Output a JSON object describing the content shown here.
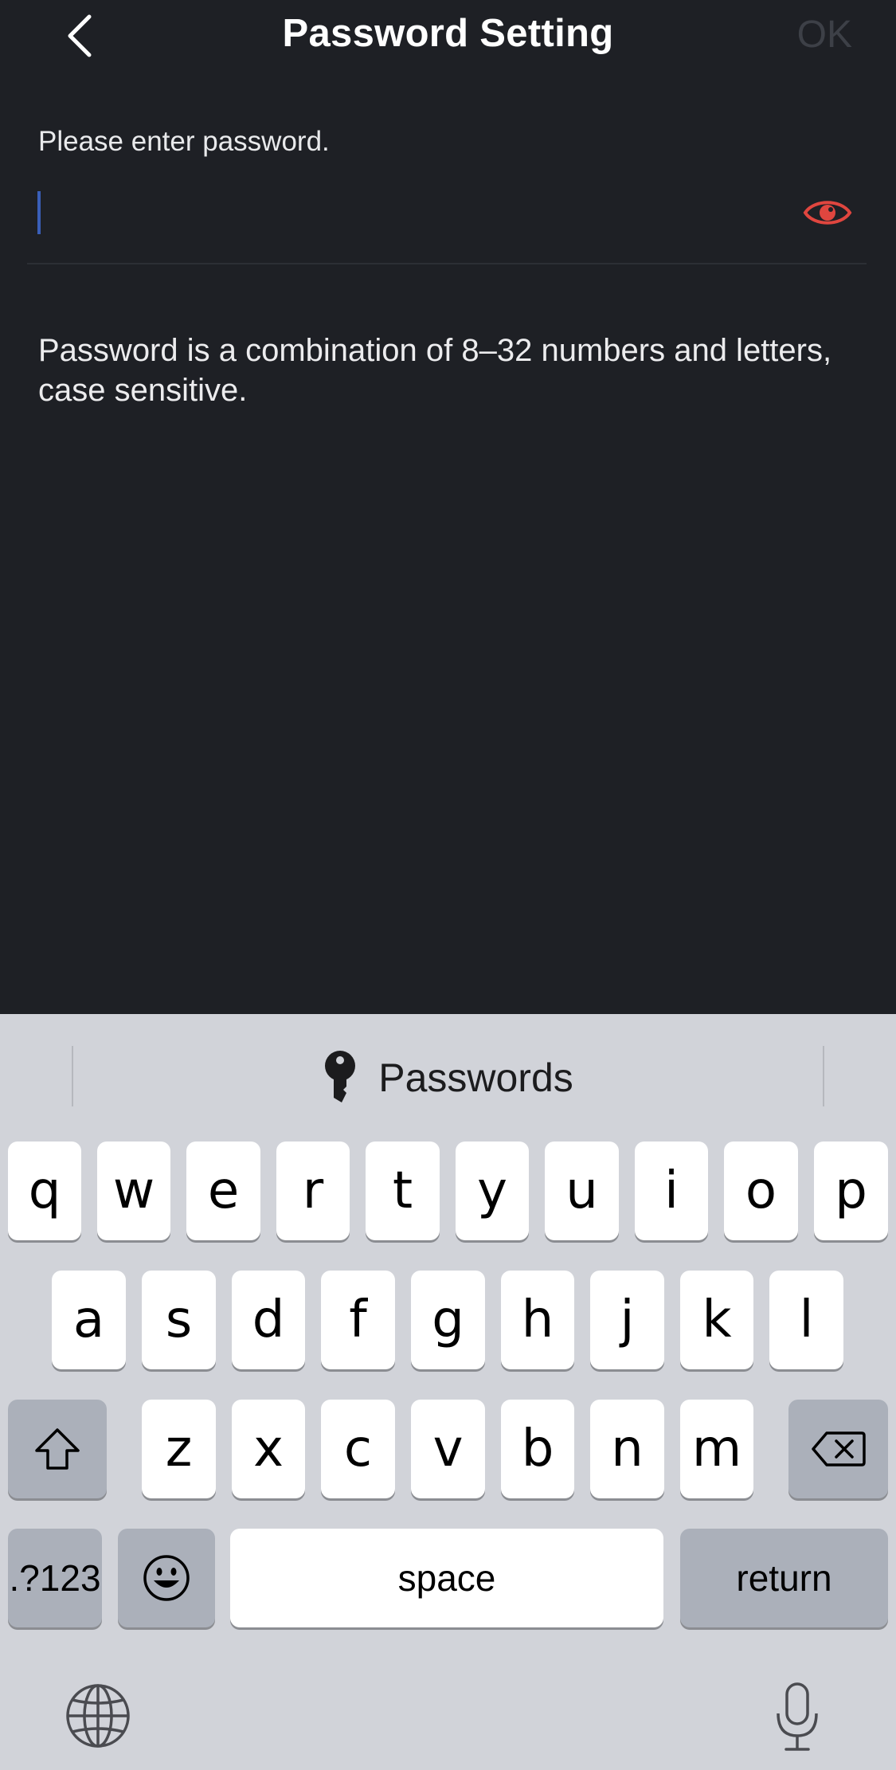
{
  "header": {
    "title": "Password Setting",
    "ok_label": "OK"
  },
  "form": {
    "label": "Please enter password.",
    "password_value": "",
    "hint": "Password is a combination of 8–32 numbers and letters, case sensitive."
  },
  "colors": {
    "background": "#1e2025",
    "accent": "#e0463f",
    "ok_disabled": "#3d4047"
  },
  "keyboard": {
    "suggestion": "Passwords",
    "row1": [
      "q",
      "w",
      "e",
      "r",
      "t",
      "y",
      "u",
      "i",
      "o",
      "p"
    ],
    "row2": [
      "a",
      "s",
      "d",
      "f",
      "g",
      "h",
      "j",
      "k",
      "l"
    ],
    "row3": [
      "z",
      "x",
      "c",
      "v",
      "b",
      "n",
      "m"
    ],
    "numbers_key": ".?123",
    "space_key": "space",
    "return_key": "return"
  },
  "icons": {
    "back": "chevron-left-icon",
    "visibility": "eye-icon",
    "suggestion": "key-icon",
    "shift": "shift-icon",
    "delete": "backspace-icon",
    "emoji": "emoji-icon",
    "globe": "globe-icon",
    "mic": "microphone-icon"
  }
}
